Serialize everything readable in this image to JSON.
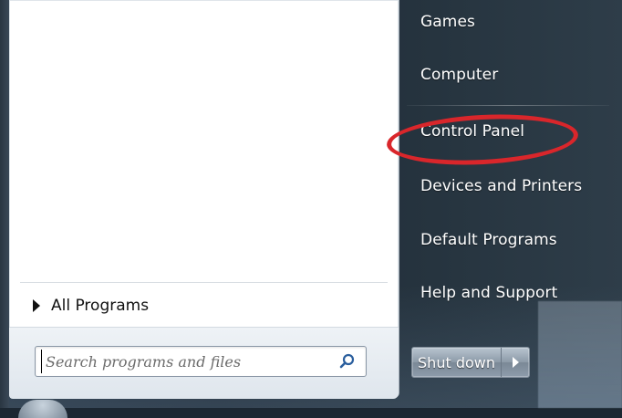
{
  "right_column": {
    "items": [
      {
        "label": "Games",
        "name": "games"
      },
      {
        "label": "Computer",
        "name": "computer"
      },
      {
        "label": "Control Panel",
        "name": "control-panel"
      },
      {
        "label": "Devices and Printers",
        "name": "devices-and-printers"
      },
      {
        "label": "Default Programs",
        "name": "default-programs"
      },
      {
        "label": "Help and Support",
        "name": "help-and-support"
      }
    ]
  },
  "programs": {
    "all_programs_label": "All Programs"
  },
  "search": {
    "placeholder": "Search programs and files",
    "icon": "search-icon"
  },
  "shutdown": {
    "label": "Shut down",
    "options_icon": "chevron-right-icon"
  },
  "colors": {
    "highlight_ellipse": "#d9262b",
    "panel_background": "#ffffff",
    "right_column_text": "#ffffff"
  }
}
